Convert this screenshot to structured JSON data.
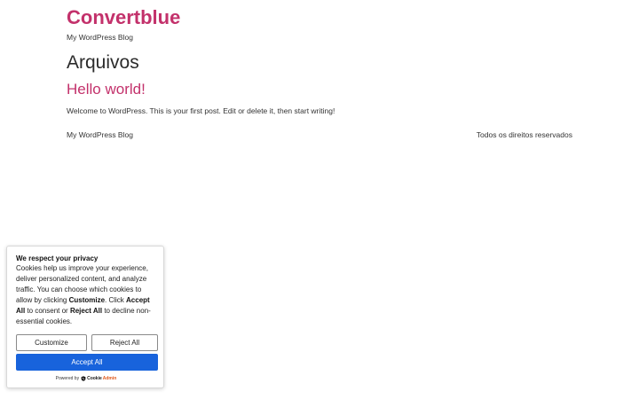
{
  "site": {
    "title": "Convertblue",
    "tagline": "My WordPress Blog"
  },
  "archive": {
    "title": "Arquivos"
  },
  "post": {
    "title": "Hello world!",
    "excerpt": "Welcome to WordPress. This is your first post. Edit or delete it, then start writing!"
  },
  "footer": {
    "left": "My WordPress Blog",
    "right": "Todos os direitos reservados"
  },
  "cookie": {
    "title": "We respect your privacy",
    "text_1": "Cookies help us improve your experience, deliver personalized content, and analyze traffic. You can choose which cookies to allow by clicking ",
    "text_customize": "Customize",
    "text_2": ". Click ",
    "text_accept": "Accept All",
    "text_3": " to consent or ",
    "text_reject": "Reject All",
    "text_4": " to decline non-essential cookies.",
    "customize_label": "Customize",
    "reject_label": "Reject All",
    "accept_label": "Accept All",
    "powered_by": "Powered by",
    "brand_a": "Cookie",
    "brand_b": "Admin"
  },
  "colors": {
    "accent": "#c3316b",
    "primary_button": "#1863dc",
    "text": "#333333"
  },
  "icons": {
    "brand": "cookieadmin-logo-icon"
  }
}
